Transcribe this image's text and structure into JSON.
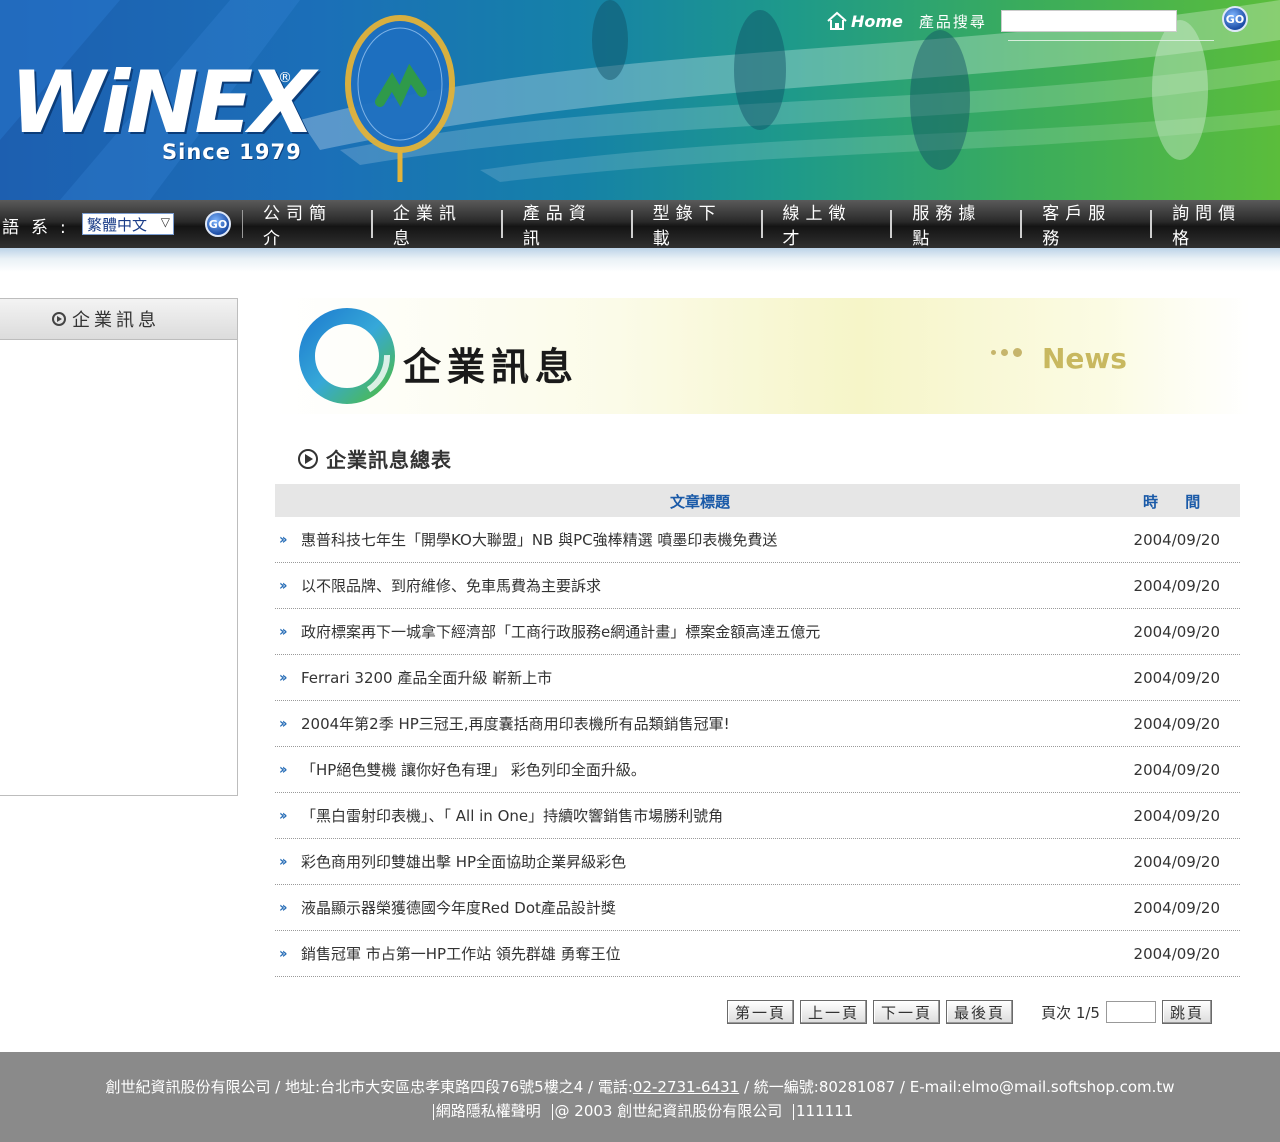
{
  "header": {
    "logo": "WiNEX",
    "logo_reg": "®",
    "since": "Since 1979",
    "home_label": "Home",
    "search_label": "產品搜尋",
    "search_value": "",
    "go_label": "GO"
  },
  "nav": {
    "lang_label": "語系:",
    "lang_selected": "繁體中文",
    "go_label": "GO",
    "items": [
      "公司簡介",
      "企業訊息",
      "產品資訊",
      "型錄下載",
      "線上徵才",
      "服務據點",
      "客戶服務",
      "詢問價格"
    ]
  },
  "sidebar": {
    "heading": "企業訊息"
  },
  "banner": {
    "title": "企業訊息",
    "news": "News"
  },
  "section": {
    "heading": "企業訊息總表"
  },
  "table": {
    "col_title": "文章標題",
    "col_time": "時 間",
    "rows": [
      {
        "title": "惠普科技七年生「開學KO大聯盟」NB 與PC強棒精選 噴墨印表機免費送",
        "date": "2004/09/20"
      },
      {
        "title": "以不限品牌、到府維修、免車馬費為主要訴求",
        "date": "2004/09/20"
      },
      {
        "title": "政府標案再下一城拿下經濟部「工商行政服務e網通計畫」標案金額高達五億元",
        "date": "2004/09/20"
      },
      {
        "title": "Ferrari 3200 產品全面升級 嶄新上市",
        "date": "2004/09/20"
      },
      {
        "title": " 2004年第2季 HP三冠王,再度囊括商用印表機所有品類銷售冠軍!",
        "date": "2004/09/20"
      },
      {
        "title": "「HP絕色雙機 讓你好色有理」 彩色列印全面升級。",
        "date": "2004/09/20"
      },
      {
        "title": "「黑白雷射印表機」、「 All in One」持續吹響銷售市場勝利號角",
        "date": "2004/09/20"
      },
      {
        "title": "彩色商用列印雙雄出擊 HP全面協助企業昇級彩色",
        "date": "2004/09/20"
      },
      {
        "title": "液晶顯示器榮獲德國今年度Red Dot產品設計獎",
        "date": "2004/09/20"
      },
      {
        "title": "銷售冠軍 市占第一HP工作站 領先群雄 勇奪王位",
        "date": "2004/09/20"
      }
    ]
  },
  "pager": {
    "first": "第一頁",
    "prev": "上一頁",
    "next": "下一頁",
    "last": "最後頁",
    "page_info": "頁次 1/5",
    "jump": "跳頁"
  },
  "footer": {
    "line1_a": "創世紀資訊股份有限公司 / 地址:台北市大安區忠孝東路四段76號5樓之4 / 電話:",
    "phone": "02-2731-6431",
    "line1_b": " / 統一編號:80281087 / E-mail:elmo@mail.softshop.com.tw",
    "privacy": "網路隱私權聲明",
    "copyright": "@ 2003 創世紀資訊股份有限公司",
    "counter": "111111"
  },
  "colors": {
    "nav_bg": "#1a1a1a",
    "link_blue": "#1a5aa8",
    "footer_bg": "#8a8a8a",
    "news_gold": "#c8b85f"
  },
  "icons": {
    "home": "home-icon",
    "go": "go-button-icon",
    "row_arrow": "double-chevron-icon",
    "heading": "circle-play-icon"
  }
}
